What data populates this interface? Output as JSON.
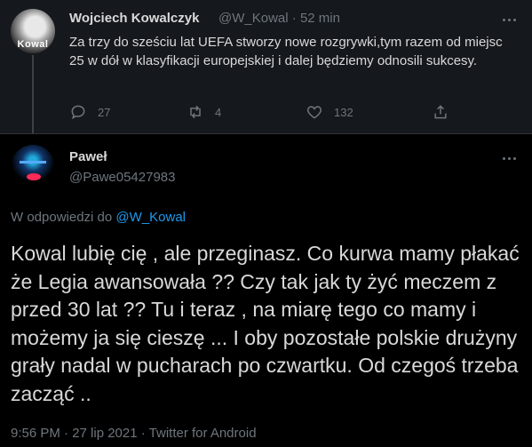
{
  "parent_tweet": {
    "author_name": "Wojciech Kowalczyk",
    "handle": "@W_Kowal",
    "separator": "·",
    "time_ago": "52 min",
    "avatar_text": "Kowal",
    "text": "Za trzy do sześciu lat UEFA stworzy nowe rozgrywki,tym razem od miejsc 25 w dół w klasyfikacji europejskiej i dalej będziemy odnosili sukcesy.",
    "replies": "27",
    "retweets": "4",
    "likes": "132"
  },
  "reply_tweet": {
    "author_name": "Paweł",
    "handle": "@Pawe05427983",
    "reply_prefix": "W odpowiedzi do",
    "reply_target": "@W_Kowal",
    "text": "Kowal lubię cię , ale przeginasz. Co kurwa mamy płakać że Legia awansowała ?? Czy tak jak ty żyć meczem z przed 30 lat ?? Tu i teraz , na miarę tego co mamy i możemy ja się cieszę ... I oby pozostałe polskie  drużyny grały nadal w pucharach po czwartku. Od czegoś trzeba zacząć ..",
    "footer": "9:56 PM · 27 lip 2021 · Twitter for Android"
  },
  "colors": {
    "background": "#000000",
    "parent_background": "#15181c",
    "muted": "#6e767d",
    "link": "#1d9bf0",
    "text": "#d9d9d9"
  },
  "icons": [
    "reply-icon",
    "retweet-icon",
    "like-icon",
    "share-icon",
    "more-icon"
  ]
}
